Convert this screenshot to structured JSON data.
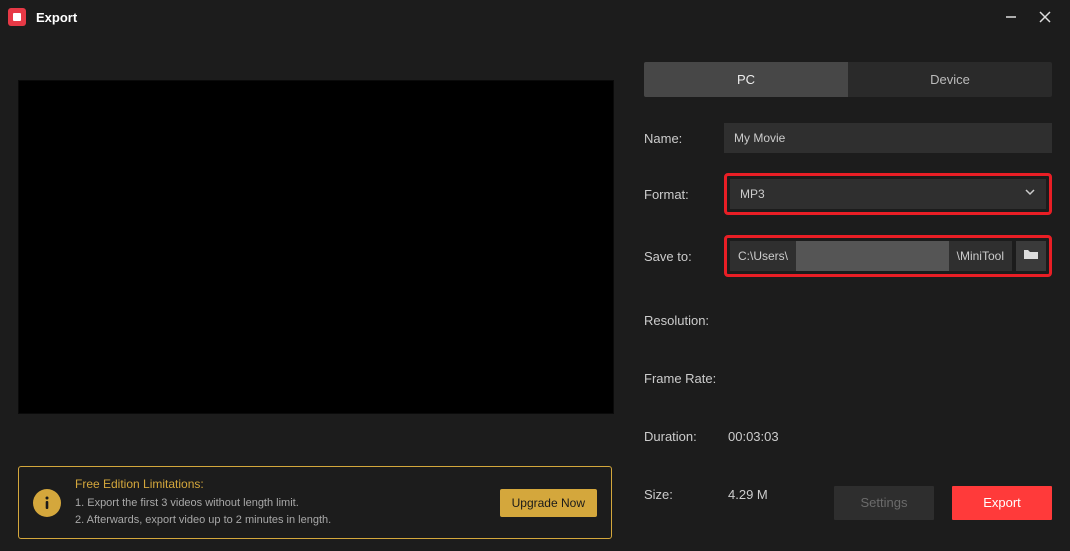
{
  "window": {
    "title": "Export"
  },
  "tabs": {
    "pc": "PC",
    "device": "Device"
  },
  "labels": {
    "name": "Name:",
    "format": "Format:",
    "saveTo": "Save to:",
    "resolution": "Resolution:",
    "frameRate": "Frame Rate:",
    "duration": "Duration:",
    "size": "Size:"
  },
  "values": {
    "name": "My Movie",
    "format": "MP3",
    "savePathPrefix": "C:\\Users\\",
    "savePathSuffix": "\\MiniTool",
    "resolution": "",
    "frameRate": "",
    "duration": "00:03:03",
    "size": "4.29 M"
  },
  "limitations": {
    "title": "Free Edition Limitations:",
    "line1": "1. Export the first 3 videos without length limit.",
    "line2": "2. Afterwards, export video up to 2 minutes in length.",
    "upgrade": "Upgrade Now"
  },
  "buttons": {
    "settings": "Settings",
    "export": "Export"
  }
}
